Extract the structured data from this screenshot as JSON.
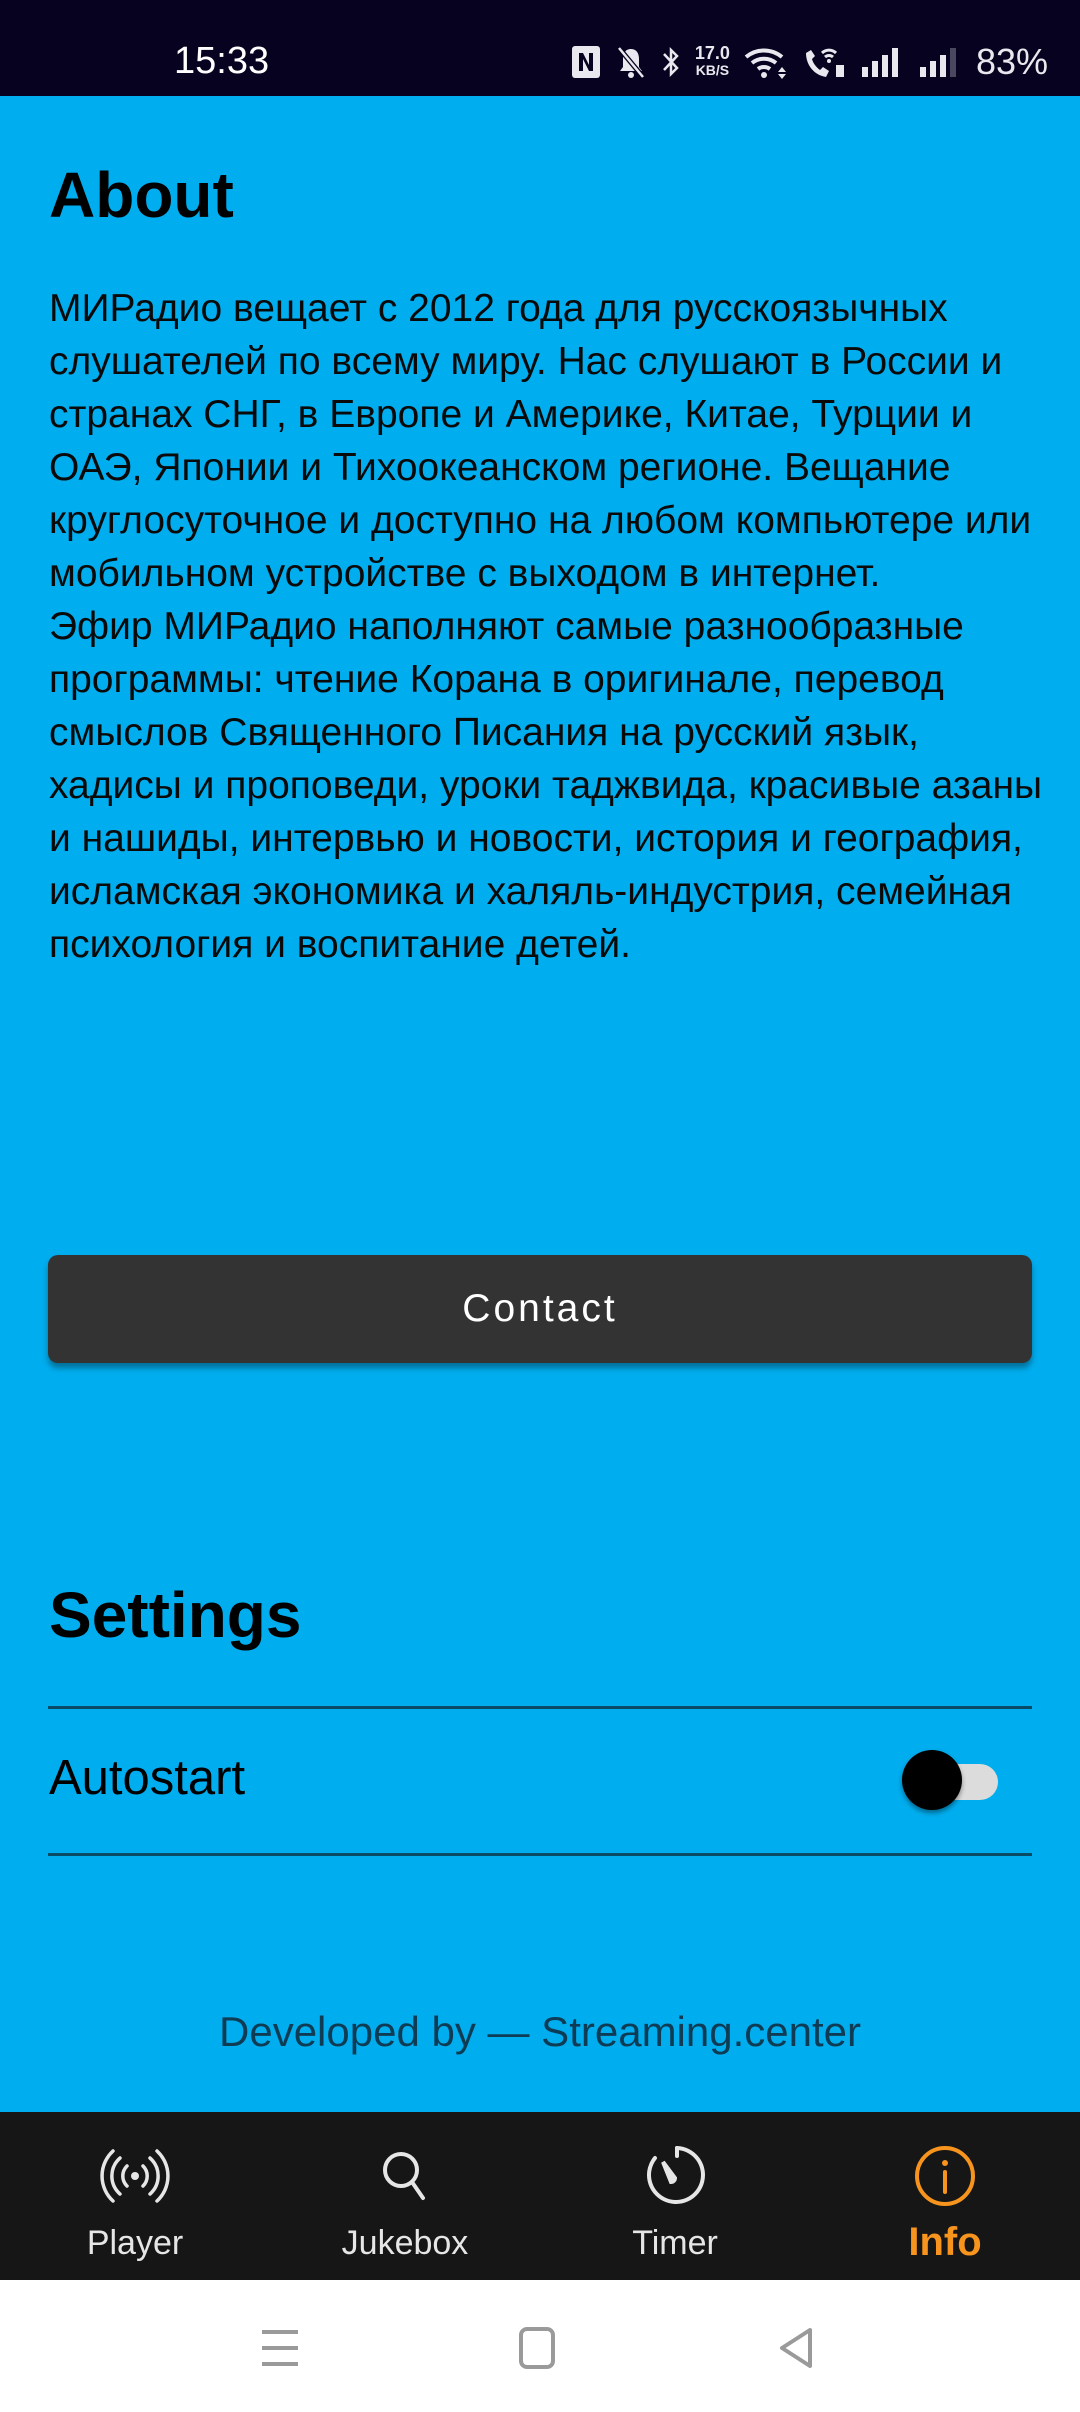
{
  "status_bar": {
    "time": "15:33",
    "net_speed_value": "17.0",
    "net_speed_unit": "KB/S",
    "battery": "83%",
    "icons": [
      "nfc-icon",
      "bell-muted-icon",
      "bluetooth-icon",
      "wifi-icon",
      "wifi-calling-icon",
      "signal-icon",
      "signal-icon"
    ]
  },
  "about": {
    "title": "About",
    "paragraphs": [
      "МИРадио вещает с 2012 года для русскоязычных слушателей по всему миру. Нас слушают в России и странах СНГ, в Европе и Америке, Китае, Турции и ОАЭ, Японии и Тихоокеанском регионе. Вещание круглосуточное и доступно на любом компьютере или мобильном устройстве с выходом в интернет.",
      "Эфир МИРадио наполняют самые разнообразные программы: чтение Корана в оригинале, перевод смыслов Священного Писания на русский язык, хадисы и проповеди, уроки таджвида, красивые азаны и нашиды, интервью и новости, история и география, исламская экономика и халяль-индустрия, семейная психология и воспитание детей."
    ],
    "contact_label": "Contact"
  },
  "settings": {
    "title": "Settings",
    "autostart_label": "Autostart",
    "autostart_enabled": false
  },
  "footer": {
    "developed_by": "Developed by — Streaming.center"
  },
  "bottom_nav": {
    "items": [
      {
        "label": "Player",
        "icon": "broadcast-icon",
        "active": false
      },
      {
        "label": "Jukebox",
        "icon": "search-icon",
        "active": false
      },
      {
        "label": "Timer",
        "icon": "timer-icon",
        "active": false
      },
      {
        "label": "Info",
        "icon": "info-icon",
        "active": true
      }
    ]
  },
  "colors": {
    "background": "#00adee",
    "status_bar": "#07021f",
    "button": "#333333",
    "nav_bg": "#161616",
    "accent": "#f7941d"
  }
}
